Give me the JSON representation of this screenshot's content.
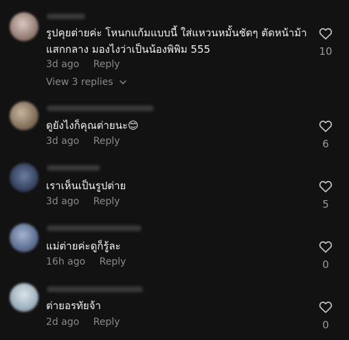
{
  "comments": [
    {
      "text": "รูปคุยต่ายค่ะ โหนกแก้มแบบนี้ ใส่แหวนหมั้นชัดๆ ตัดหน้าม้าแสกกลาง มองไงว่าเป็นน้องพิพิม 555",
      "time": "3d ago",
      "reply_label": "Reply",
      "likes": "10",
      "view_replies": "View 3 replies",
      "avatar_color": "#b8a39a"
    },
    {
      "text": "ดูยังไงก็คุณต่ายนะ😊",
      "time": "3d ago",
      "reply_label": "Reply",
      "likes": "6",
      "avatar_color": "#9b8a76"
    },
    {
      "text": "เราเห็นเป็นรูปต่าย",
      "time": "3d ago",
      "reply_label": "Reply",
      "likes": "5",
      "avatar_color": "#4a5a78"
    },
    {
      "text": "แม่ต่ายค่ะดูก็รู้ละ",
      "time": "16h ago",
      "reply_label": "Reply",
      "likes": "0",
      "avatar_color": "#6d7f9e"
    },
    {
      "text": "ต่ายอรทัยจ้า",
      "time": "2d ago",
      "reply_label": "Reply",
      "likes": "0",
      "avatar_color": "#a7b8c4"
    }
  ]
}
